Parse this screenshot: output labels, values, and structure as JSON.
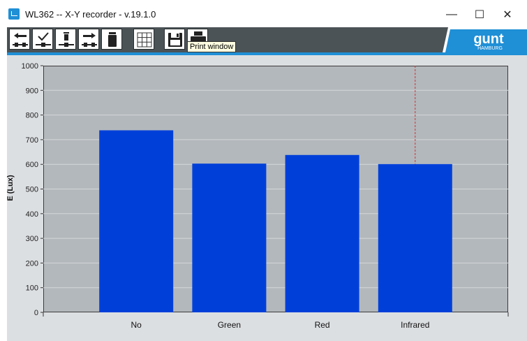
{
  "window": {
    "title": "WL362 -- X-Y recorder - v.19.1.0",
    "minimize": "—",
    "maximize": "☐",
    "close": "✕"
  },
  "toolbar": {
    "tooltip": "Print window",
    "buttons": [
      {
        "name": "back-icon"
      },
      {
        "name": "check-icon"
      },
      {
        "name": "delete-point-icon"
      },
      {
        "name": "forward-icon"
      },
      {
        "name": "trash-icon"
      },
      {
        "name": "grid-icon"
      },
      {
        "name": "save-icon"
      },
      {
        "name": "print-icon"
      }
    ]
  },
  "logo": {
    "brand": "gunt",
    "subtitle": "HAMBURG"
  },
  "colors": {
    "bar": "#0040d9",
    "plot_bg": "#b3b8bc",
    "accent": "#1f8fd6",
    "marker": "#d03030"
  },
  "chart_data": {
    "type": "bar",
    "categories": [
      "No",
      "Green",
      "Red",
      "Infrared"
    ],
    "values": [
      738,
      603,
      638,
      601
    ],
    "xlabel": "",
    "ylabel": "E (Lux)",
    "ylim": [
      0,
      1000
    ],
    "yticks": [
      0,
      100,
      200,
      300,
      400,
      500,
      600,
      700,
      800,
      900,
      1000
    ],
    "grid": true,
    "marker_category": "Infrared"
  }
}
